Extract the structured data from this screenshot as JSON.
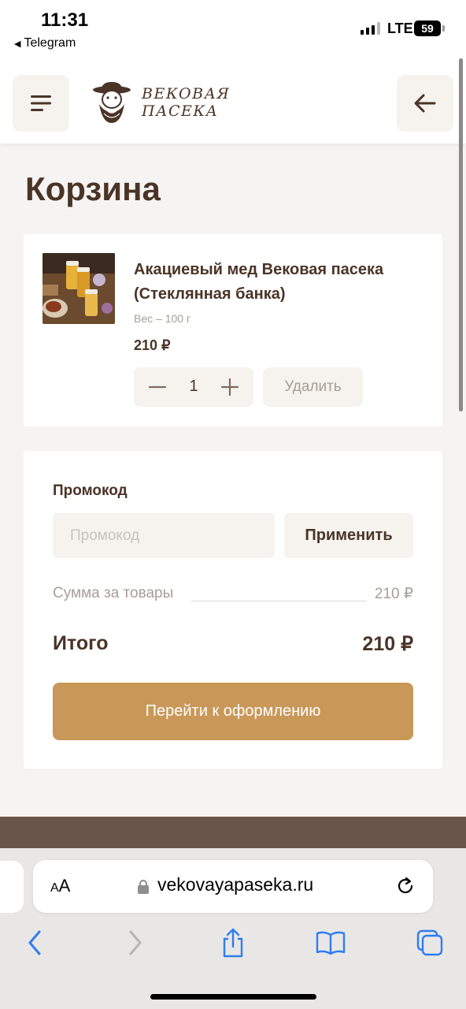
{
  "status_bar": {
    "time": "11:31",
    "back_app": "Telegram",
    "network": "LTE",
    "battery": "59"
  },
  "header": {
    "logo_line1": "ВЕКОВАЯ",
    "logo_line2": "ПАСЕКА"
  },
  "page": {
    "title": "Корзина"
  },
  "cart": {
    "items": [
      {
        "name": "Акациевый мед Вековая пасека (Стеклянная банка)",
        "weight": "Вес – 100 г",
        "price": "210 ₽",
        "quantity": "1",
        "delete_label": "Удалить"
      }
    ]
  },
  "summary": {
    "promo_label": "Промокод",
    "promo_placeholder": "Промокод",
    "promo_value": "",
    "apply_label": "Применить",
    "goods_label": "Сумма за товары",
    "goods_value": "210 ₽",
    "total_label": "Итого",
    "total_value": "210 ₽",
    "checkout_label": "Перейти к оформлению"
  },
  "browser": {
    "aa_small": "A",
    "aa_large": "A",
    "url": "vekovayapaseka.ru"
  },
  "colors": {
    "brand_brown": "#4a3426",
    "accent_gold": "#c99859",
    "muted": "#a79e97",
    "footer": "#6a554a"
  }
}
